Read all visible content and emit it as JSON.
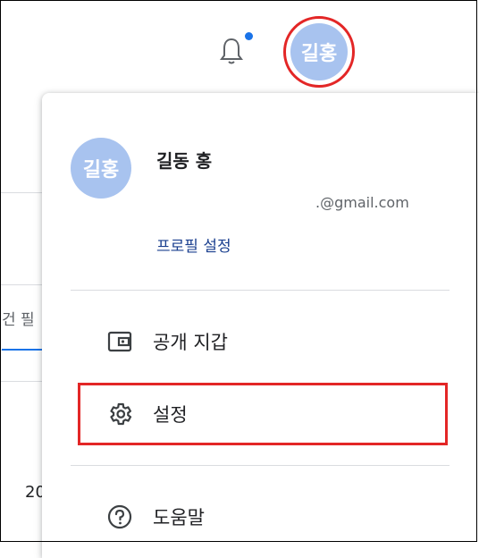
{
  "background": {
    "tab_partial_text": "건 필",
    "year_partial_text": "20"
  },
  "topbar": {
    "avatar_initials": "길홍",
    "notification_dot_color": "#1a73e8"
  },
  "account_menu": {
    "avatar_initials": "길홍",
    "user_name": "길동 홍",
    "email": ".@gmail.com",
    "profile_settings_label": "프로필 설정",
    "items": [
      {
        "label": "공개 지갑",
        "icon": "wallet-icon"
      },
      {
        "label": "설정",
        "icon": "gear-icon"
      },
      {
        "label": "도움말",
        "icon": "help-icon"
      }
    ]
  },
  "colors": {
    "accent_blue": "#1a73e8",
    "avatar_bg": "#a8c3ef",
    "highlight_red": "#e32626"
  }
}
